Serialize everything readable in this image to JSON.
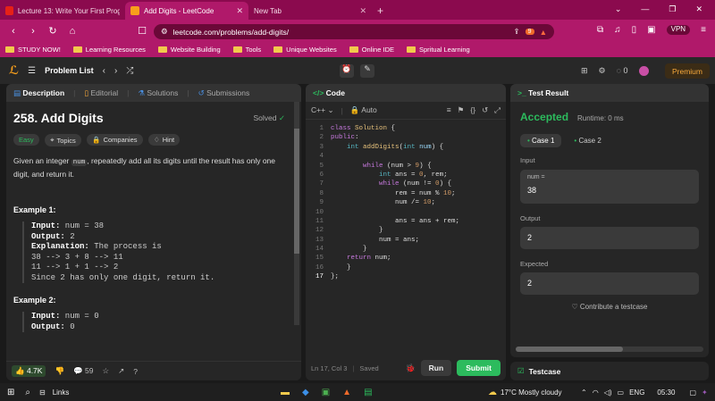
{
  "browser": {
    "tabs": [
      {
        "title": "Lecture 13: Write Your First Program"
      },
      {
        "title": "Add Digits - LeetCode"
      },
      {
        "title": "New Tab"
      }
    ],
    "url": "leetcode.com/problems/add-digits/",
    "vpn": "VPN",
    "shield_badge": "9"
  },
  "bookmarks": [
    "STUDY NOW!",
    "Learning Resources",
    "Website Building",
    "Tools",
    "Unique Websites",
    "Online IDE",
    "Spritual Learning"
  ],
  "lc": {
    "problem_list": "Problem List",
    "fire_count": "0",
    "premium": "Premium"
  },
  "desc": {
    "tabs": [
      "Description",
      "Editorial",
      "Solutions",
      "Submissions"
    ],
    "title": "258. Add Digits",
    "solved": "Solved",
    "chips": [
      "Easy",
      "Topics",
      "Companies",
      "Hint"
    ],
    "statement_1": "Given an integer",
    "statement_code": "num",
    "statement_2": ", repeatedly add all its digits until the result has only one digit, and return it.",
    "ex1_title": "Example 1:",
    "ex1_input_l": "Input:",
    "ex1_input": " num = 38",
    "ex1_output_l": "Output:",
    "ex1_output": " 2",
    "ex1_expl_l": "Explanation:",
    "ex1_expl": " The process is",
    "ex1_l1": "38 --> 3 + 8 --> 11",
    "ex1_l2": "11 --> 1 + 1 --> 2",
    "ex1_l3": "Since 2 has only one digit, return it.",
    "ex2_title": "Example 2:",
    "ex2_input_l": "Input:",
    "ex2_input": " num = 0",
    "ex2_output_l": "Output:",
    "ex2_output": " 0",
    "likes": "4.7K",
    "comments": "59"
  },
  "code": {
    "header": "Code",
    "lang": "C++",
    "mode": "Auto",
    "status": "Ln 17, Col 3",
    "saved": "Saved",
    "run": "Run",
    "submit": "Submit"
  },
  "result": {
    "header": "Test Result",
    "verdict": "Accepted",
    "runtime": "Runtime: 0 ms",
    "cases": [
      "Case 1",
      "Case 2"
    ],
    "input_label": "Input",
    "var_name": "num =",
    "var_value": "38",
    "output_label": "Output",
    "output_value": "2",
    "expected_label": "Expected",
    "expected_value": "2",
    "contribute": "Contribute a testcase",
    "testcase_tab": "Testcase"
  },
  "taskbar": {
    "links": "Links",
    "weather": "17°C  Mostly cloudy",
    "lang": "ENG",
    "time": "05:30"
  }
}
